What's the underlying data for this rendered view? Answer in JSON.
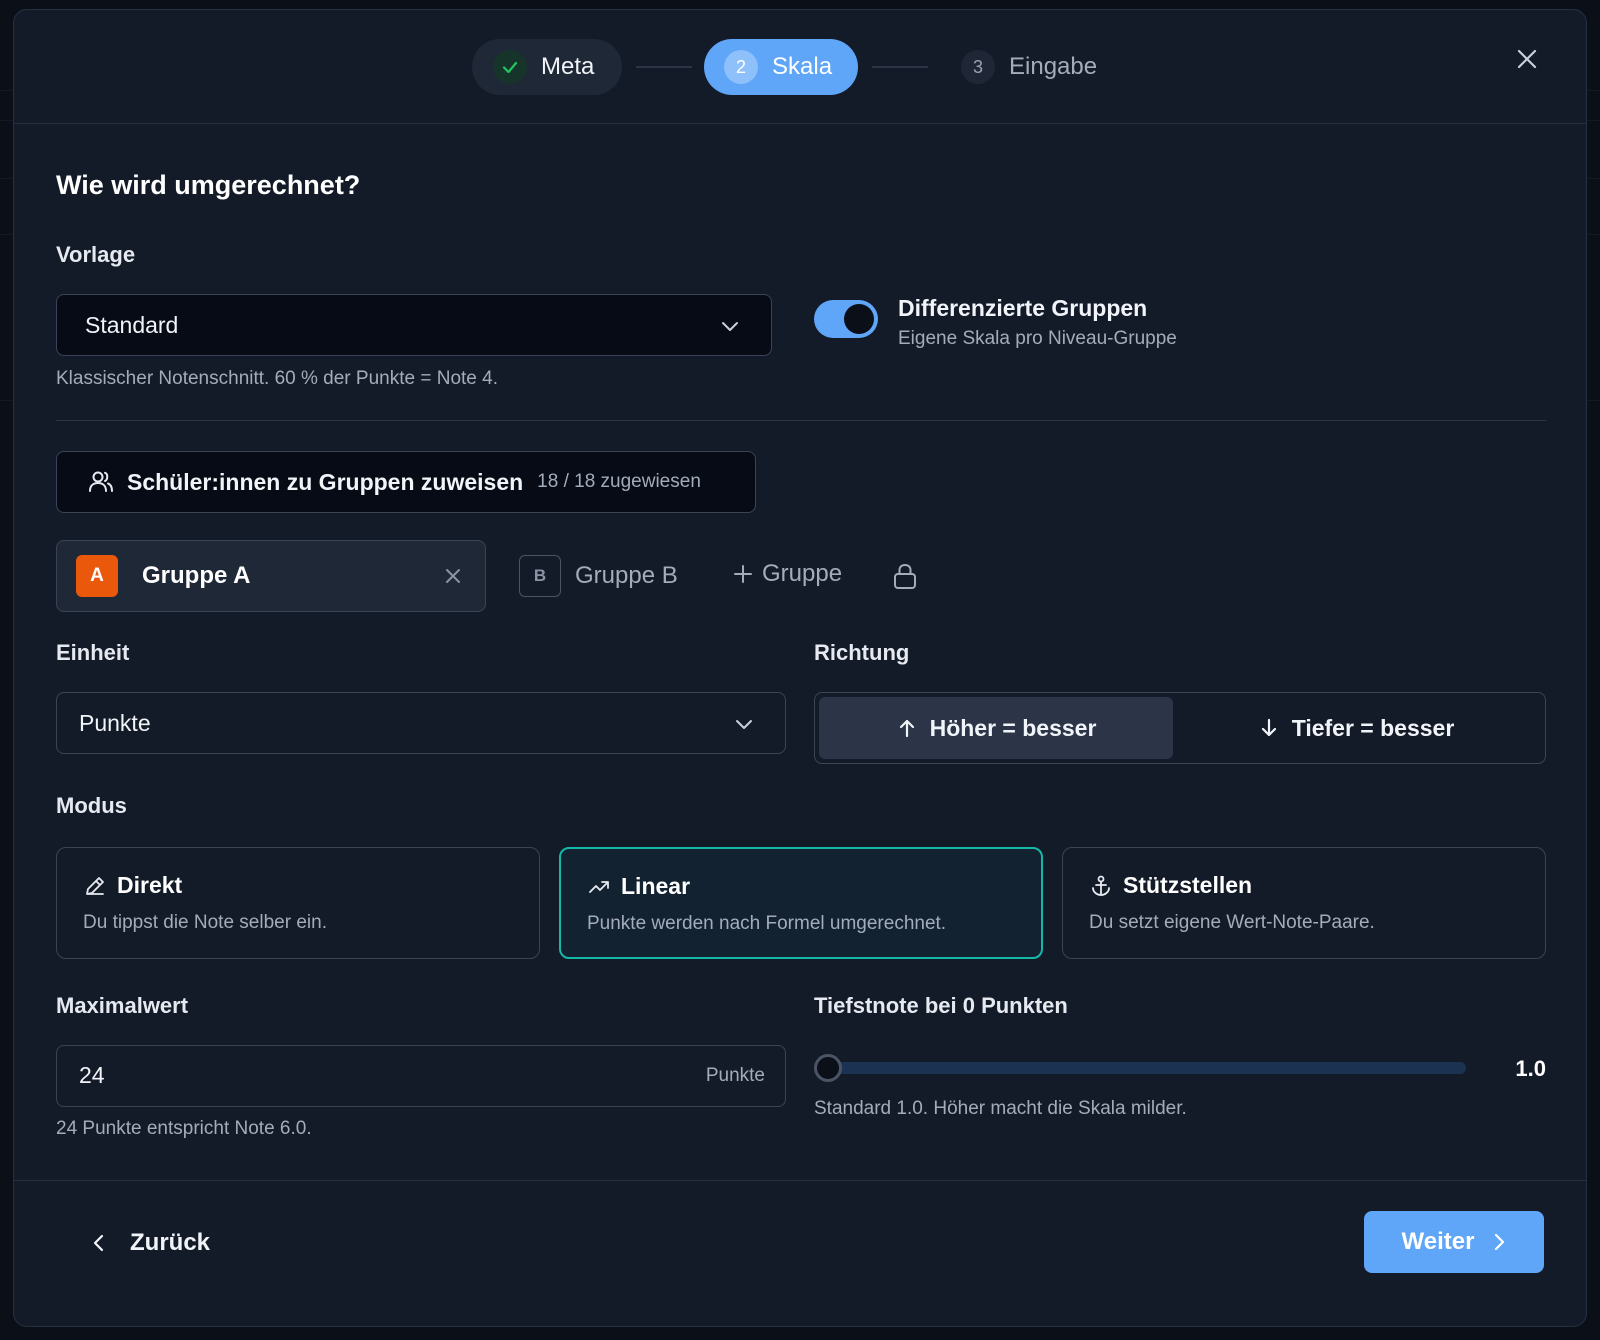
{
  "stepper": {
    "steps": [
      {
        "label": "Meta",
        "number": "",
        "state": "done"
      },
      {
        "label": "Skala",
        "number": "2",
        "state": "active"
      },
      {
        "label": "Eingabe",
        "number": "3",
        "state": "upcoming"
      }
    ]
  },
  "heading": "Wie wird umgerechnet?",
  "vorlage": {
    "label": "Vorlage",
    "value": "Standard",
    "hint": "Klassischer Notenschnitt. 60 % der Punkte = Note 4."
  },
  "toggle": {
    "title": "Differenzierte Gruppen",
    "subtitle": "Eigene Skala pro Niveau-Gruppe",
    "on": true
  },
  "assign": {
    "label": "Schüler:innen zu Gruppen zuweisen",
    "count": "18 / 18 zugewiesen"
  },
  "groups": {
    "a": {
      "badge": "A",
      "name": "Gruppe A"
    },
    "b": {
      "badge": "B",
      "name": "Gruppe B"
    },
    "add_label": "Gruppe"
  },
  "einheit": {
    "label": "Einheit",
    "value": "Punkte"
  },
  "richtung": {
    "label": "Richtung",
    "higher": "Höher = besser",
    "lower": "Tiefer = besser"
  },
  "modus": {
    "label": "Modus",
    "options": [
      {
        "title": "Direkt",
        "desc": "Du tippst die Note selber ein."
      },
      {
        "title": "Linear",
        "desc": "Punkte werden nach Formel umgerechnet."
      },
      {
        "title": "Stützstellen",
        "desc": "Du setzt eigene Wert-Note-Paare."
      }
    ]
  },
  "maximalwert": {
    "label": "Maximalwert",
    "value": "24",
    "unit": "Punkte",
    "hint": "24 Punkte entspricht Note 6.0."
  },
  "tiefstnote": {
    "label": "Tiefstnote bei 0 Punkten",
    "value": "1.0",
    "hint": "Standard 1.0. Höher macht die Skala milder."
  },
  "footer": {
    "back": "Zurück",
    "next": "Weiter"
  },
  "colors": {
    "accent": "#5fa5f8",
    "group_a": "#ea580c",
    "mode_active": "#14b8a6"
  }
}
